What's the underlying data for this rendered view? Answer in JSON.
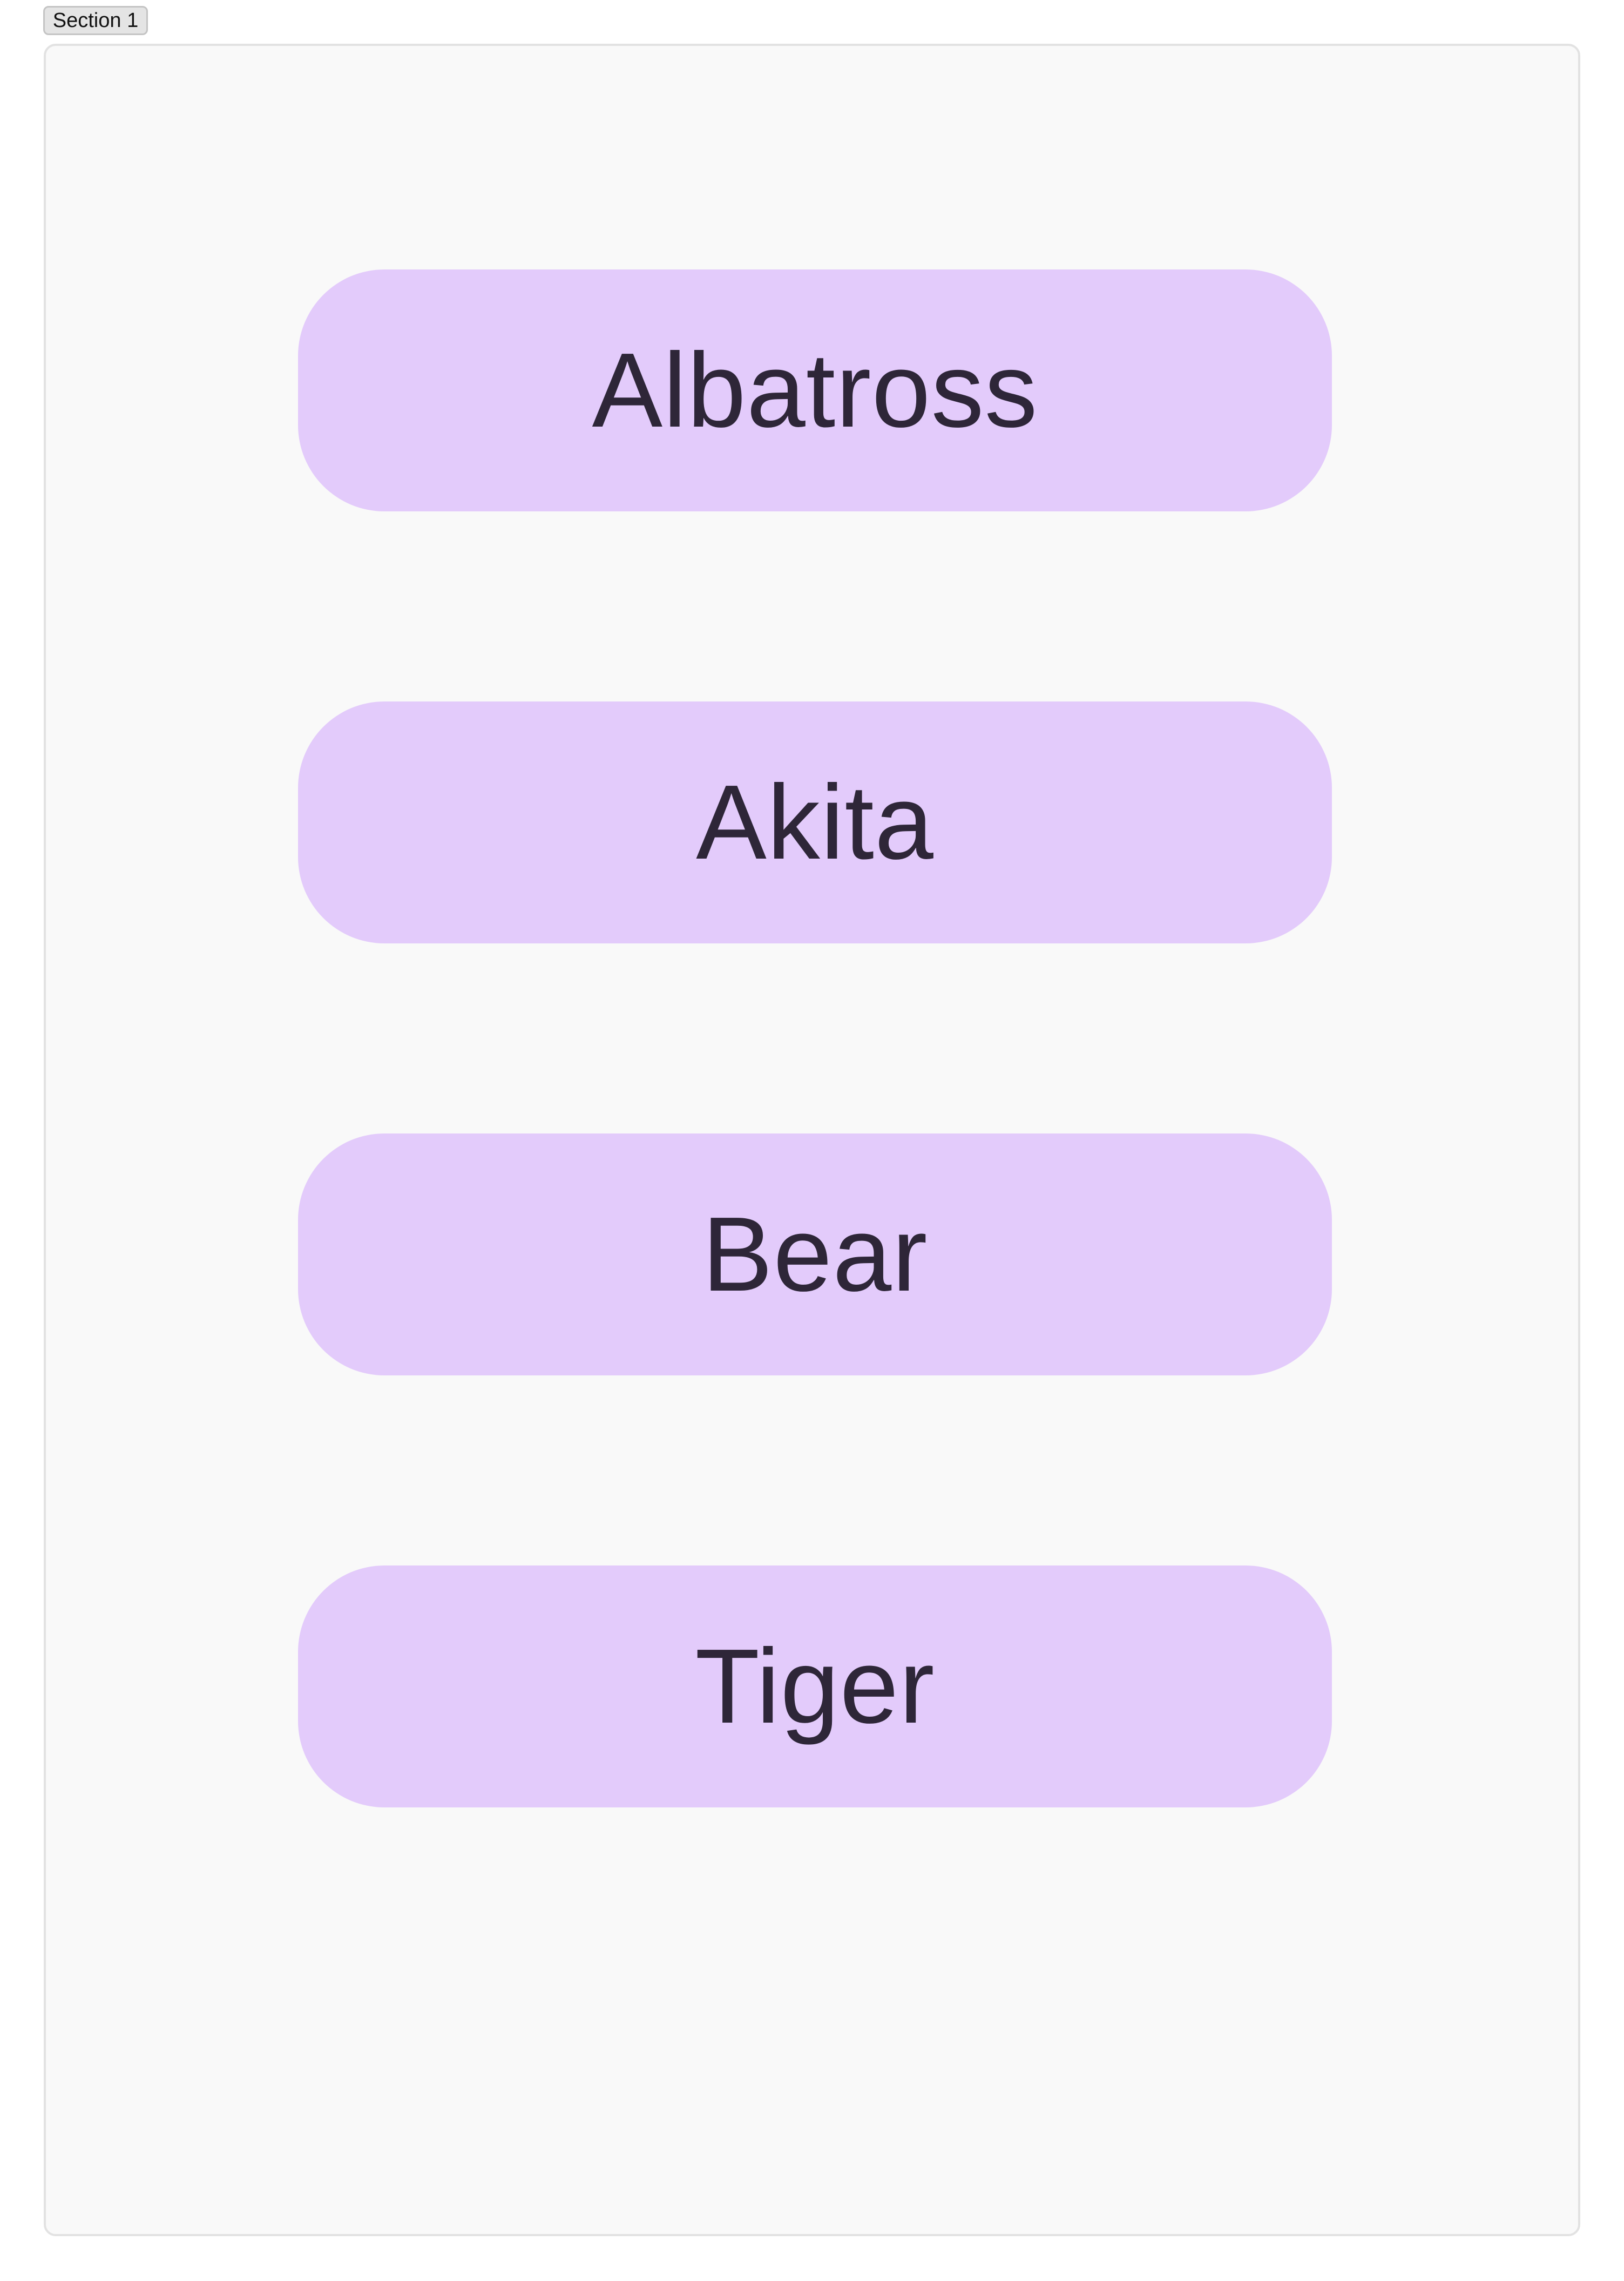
{
  "section": {
    "tab_label": "Section 1"
  },
  "choices": [
    {
      "label": "Albatross"
    },
    {
      "label": "Akita"
    },
    {
      "label": "Bear"
    },
    {
      "label": "Tiger"
    }
  ],
  "colors": {
    "button_background": "#e3cbfb",
    "button_text": "#2e2638",
    "panel_background": "#f9f9f9",
    "panel_border": "#e2e2e2"
  }
}
